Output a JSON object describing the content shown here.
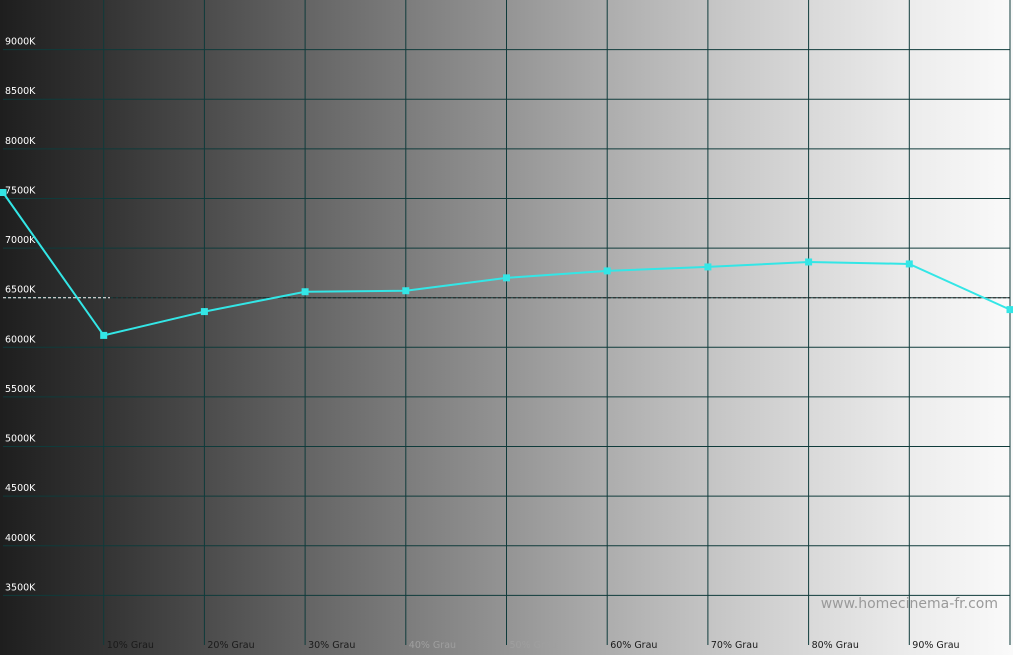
{
  "chart_data": {
    "type": "line",
    "title": "",
    "xlabel": "",
    "ylabel": "",
    "x_tick_labels": [
      "10% Grau",
      "20% Grau",
      "30% Grau",
      "40% Grau",
      "50% Grau",
      "60% Grau",
      "70% Grau",
      "80% Grau",
      "90% Grau"
    ],
    "x": [
      0,
      10,
      20,
      30,
      40,
      50,
      60,
      70,
      80,
      90,
      100
    ],
    "xlim": [
      0,
      100
    ],
    "y_tick_labels": [
      "9000K",
      "8500K",
      "8000K",
      "7500K",
      "7000K",
      "6500K",
      "6000K",
      "5500K",
      "5000K",
      "4500K",
      "4000K",
      "3500K"
    ],
    "y_ticks": [
      9000,
      8500,
      8000,
      7500,
      7000,
      6500,
      6000,
      5500,
      5000,
      4500,
      4000,
      3500
    ],
    "ylim": [
      3000,
      9500
    ],
    "series": [
      {
        "values": [
          7560,
          6120,
          6360,
          6560,
          6570,
          6700,
          6770,
          6810,
          6860,
          6840,
          6380
        ]
      }
    ],
    "reference_line": {
      "value": 6500,
      "style": "dashed"
    },
    "grid": true,
    "background": "grayscale gradient (black to white, left to right)",
    "colors": {
      "series_line": "#33e6e6",
      "grid": "#0f3b3b",
      "tick_label": "#ffffff",
      "reference_line": "#ffffff"
    }
  },
  "watermark": "www.homecinema-fr.com"
}
